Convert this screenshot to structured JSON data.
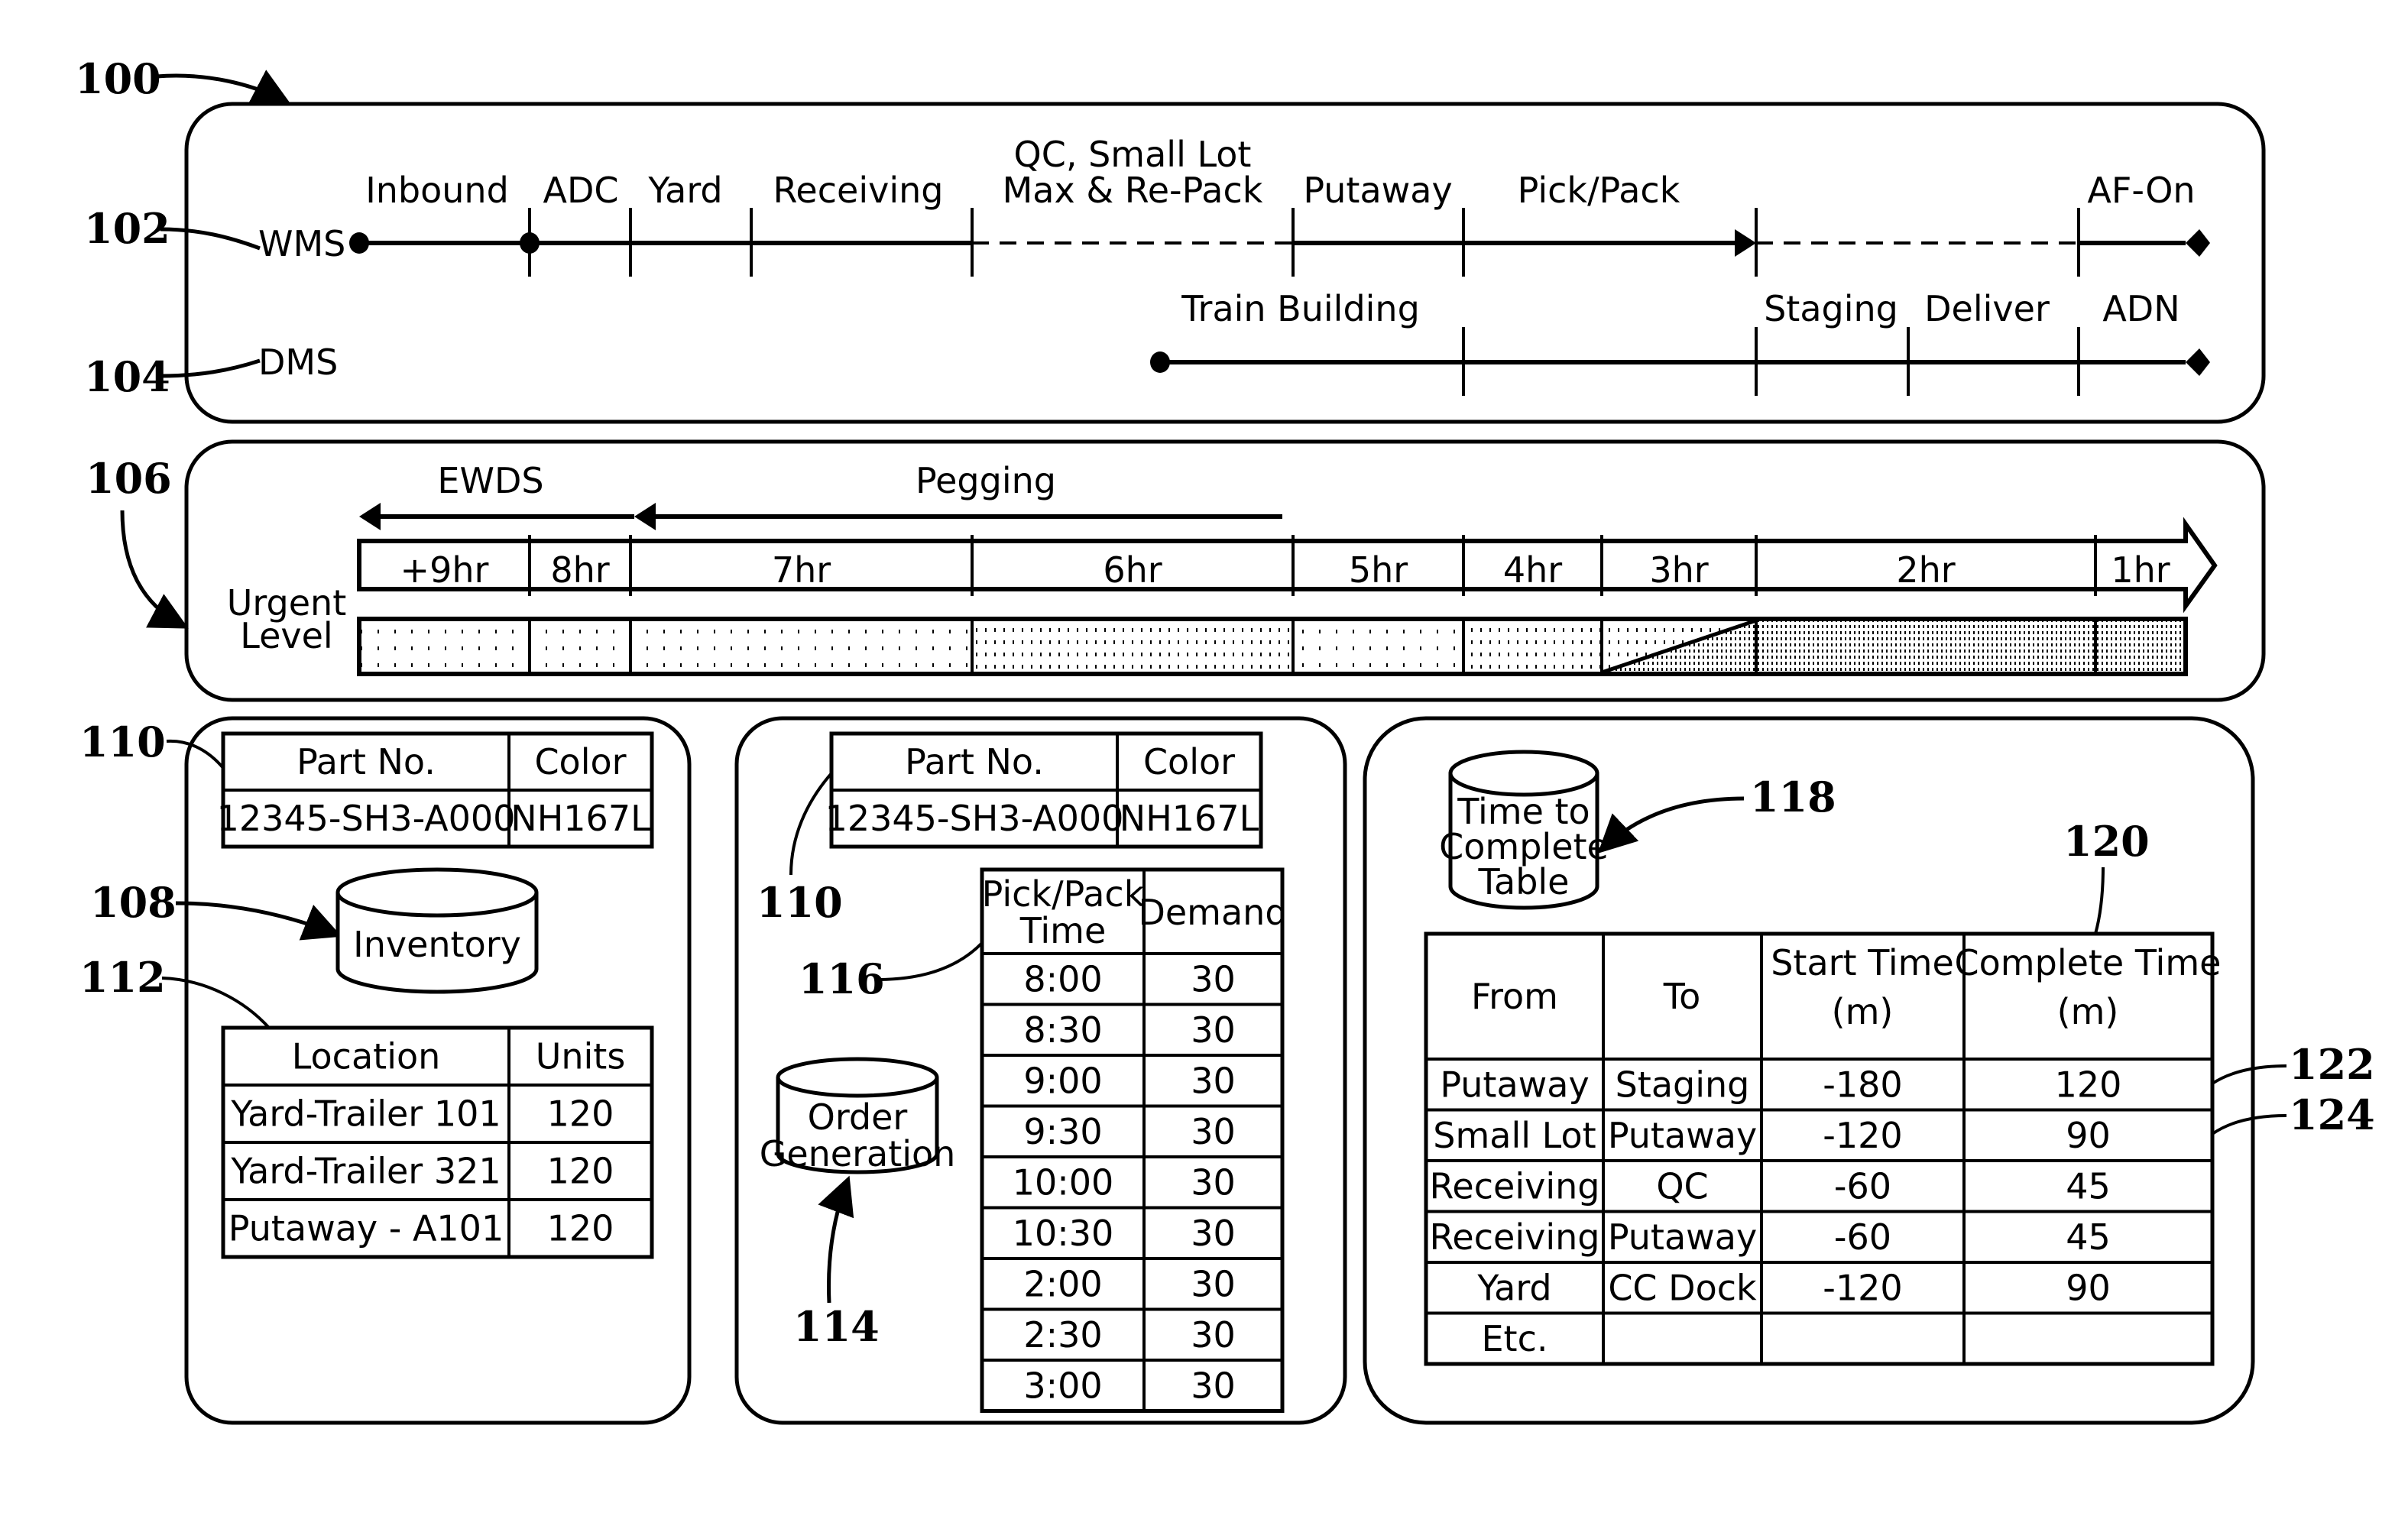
{
  "figure": {
    "ref_main": "100",
    "panels": {
      "process": {
        "ref": "100",
        "wms": {
          "ref": "102",
          "label": "WMS",
          "stages": [
            "Inbound",
            "ADC",
            "Yard",
            "Receiving",
            "QC, Small Lot",
            "Max & Re-Pack",
            "Putaway",
            "Pick/Pack",
            "AF-On"
          ]
        },
        "dms": {
          "ref": "104",
          "label": "DMS",
          "stages": [
            "Train Building",
            "Staging",
            "Deliver",
            "ADN"
          ]
        }
      },
      "timeline": {
        "ref": "106",
        "ewds_label": "EWDS",
        "pegging_label": "Pegging",
        "urgent_label_line1": "Urgent",
        "urgent_label_line2": "Level",
        "hours": [
          "+9hr",
          "8hr",
          "7hr",
          "6hr",
          "5hr",
          "4hr",
          "3hr",
          "2hr",
          "1hr"
        ],
        "urgency_density": [
          "low",
          "low",
          "low",
          "medium",
          "low",
          "medium",
          "medium-high",
          "high",
          "high"
        ]
      },
      "inventory": {
        "part_table_ref": "110",
        "db_ref": "108",
        "location_table_ref": "112",
        "db_label": "Inventory",
        "part_headers": [
          "Part No.",
          "Color"
        ],
        "part_row": [
          "12345-SH3-A000",
          "NH167L"
        ],
        "location_headers": [
          "Location",
          "Units"
        ],
        "location_rows": [
          [
            "Yard-Trailer 101",
            "120"
          ],
          [
            "Yard-Trailer 321",
            "120"
          ],
          [
            "Putaway - A101",
            "120"
          ]
        ]
      },
      "orders": {
        "part_table_ref": "110",
        "db_ref": "114",
        "demand_table_ref": "116",
        "db_label_line1": "Order",
        "db_label_line2": "Generation",
        "part_headers": [
          "Part No.",
          "Color"
        ],
        "part_row": [
          "12345-SH3-A000",
          "NH167L"
        ],
        "demand_headers": [
          "Pick/Pack",
          "Time",
          "Demand"
        ],
        "demand_rows": [
          [
            "8:00",
            "30"
          ],
          [
            "8:30",
            "30"
          ],
          [
            "9:00",
            "30"
          ],
          [
            "9:30",
            "30"
          ],
          [
            "10:00",
            "30"
          ],
          [
            "10:30",
            "30"
          ],
          [
            "2:00",
            "30"
          ],
          [
            "2:30",
            "30"
          ],
          [
            "3:00",
            "30"
          ]
        ]
      },
      "time_to_complete": {
        "db_ref": "118",
        "table_ref": "120",
        "row_ref_1": "122",
        "row_ref_2": "124",
        "db_label_line1": "Time to",
        "db_label_line2": "Complete",
        "db_label_line3": "Table",
        "headers": [
          "From",
          "To",
          "Start Time",
          "(m)",
          "Complete Time",
          "(m)"
        ],
        "rows": [
          [
            "Putaway",
            "Staging",
            "-180",
            "120"
          ],
          [
            "Small Lot",
            "Putaway",
            "-120",
            "90"
          ],
          [
            "Receiving",
            "QC",
            "-60",
            "45"
          ],
          [
            "Receiving",
            "Putaway",
            "-60",
            "45"
          ],
          [
            "Yard",
            "CC Dock",
            "-120",
            "90"
          ],
          [
            "Etc.",
            "",
            "",
            ""
          ]
        ]
      }
    }
  }
}
